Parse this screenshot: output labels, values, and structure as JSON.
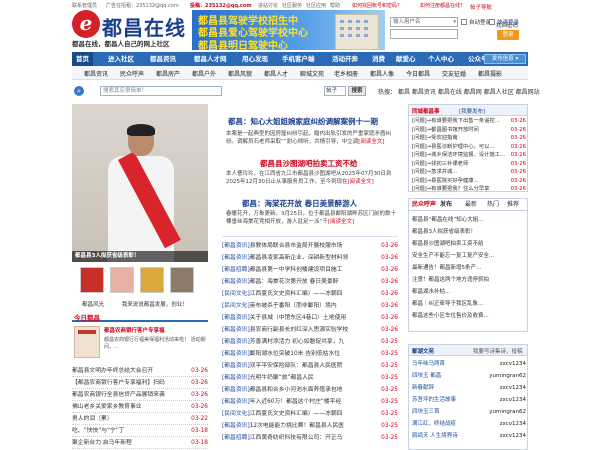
{
  "top_strip": {
    "contact": "联系管理员",
    "ad_phone": "广告在招租：235132@qq.com",
    "submit": "投稿：235132@qq.com",
    "links": [
      "进站讨论",
      "社区服务",
      "社区应用",
      "帮助"
    ],
    "forgot": "如何找回帐号和密码？",
    "register_guide": "如何注册都昌在线？"
  },
  "logo": {
    "mark": "e",
    "text": "都昌在线",
    "slogan": "都昌在线，都昌人自己的网上社区"
  },
  "banner": {
    "line1": "都昌县驾驶学校招生中",
    "line2": "都昌县爱心驾驶学校中心",
    "line3": "都昌县明日驾驶中心"
  },
  "login": {
    "username_placeholder": "输入用户名",
    "remember": "自动登录",
    "quick_login": "快速登录",
    "forgot_pw": "找回密码",
    "fast_reg": "帖子导航",
    "login_btn": "登录"
  },
  "nav": {
    "items": [
      "首页",
      "进入社区",
      "都昌资讯",
      "都昌人才网",
      "用心发现",
      "手机客户端",
      "活动开奔",
      "消费",
      "献爱心",
      "个人中心",
      "公众号"
    ],
    "publish_btn": "发布信息 ▾"
  },
  "subnav": {
    "items": [
      "都昌资讯",
      "民众呼声",
      "都昌房产",
      "都昌户外",
      "都昌风貌",
      "都昌人才",
      "聊城文苑",
      "老乡相册",
      "都昌人像",
      "今日都昌",
      "交友征婚",
      "都昌摄影"
    ]
  },
  "searchbar": {
    "placeholder": "搜索其实很简单！",
    "category": "帖子",
    "go": "搜索",
    "hot_label": "热搜：",
    "hot": [
      "都昌",
      "都昌资讯",
      "都昌在线",
      "都昌网",
      "都昌人社区",
      "都昌网站"
    ]
  },
  "feature": {
    "caption": "都昌县3人拟获省级表彰！",
    "thumbs_caption": "经台下"
  },
  "thumbs_links": [
    "都昌风光",
    "我来说说都昌发展，创业！"
  ],
  "today": {
    "title": "今日都昌",
    "ad_title": "都昌农商银行客户专享福",
    "ad_desc": "都昌农商银行行福美保福利活动来啦！ 活动期间，..."
  },
  "left_list": [
    {
      "title": "都昌县文明办年终总结大会召开",
      "date": "03-26"
    },
    {
      "title": "【都昌农商银行客户专享福利】扫码",
      "date": "03-26"
    },
    {
      "title": "都昌农商银行全县信贷产品展销来袭",
      "date": "03-26"
    },
    {
      "title": "佛山老乡关爱家乡教育事业",
      "date": "03-26"
    },
    {
      "title": "男人的泪（累）",
      "date": "03-22"
    },
    {
      "title": "吃、“快快”与“宁”丁",
      "date": "03-18"
    },
    {
      "title": "聚企新台力 启马年新程",
      "date": "03-18"
    }
  ],
  "mid": {
    "h1": "都昌：知心大姐姐婉家庭纠纷调解案例十一期",
    "p1": "本案是一起典型的因房屋纠纷引起，婚内出轨引发的严重家庭矛盾纠纷。调解员石老师采取“”耐心倾听，共情引导，中立调",
    "p1_more": "[阅读全文]",
    "h2": "都昌县沙图湖吧拍卖工资不给",
    "p2": "本人曹玲玲，在江西省九江市都昌县沙图湖吧从2025年07月30日到2025年12月30日止从事服务员工作，至今到现在",
    "p2_more": "[阅读全文]",
    "h3": "都昌：海棠花开放 春日美景醉游人",
    "p3": "春暖花开，万象更新。3月25日，位于都昌县鄱阳湖畔苏区门前的数十棵垂丝海棠花竞相开放，游人驻足一派“千",
    "p3_more": "[阅读全文]",
    "list": [
      {
        "tag": "[都昌资讯]",
        "title": "县教体局联合县市监局开展校服市场",
        "date": "03-26"
      },
      {
        "tag": "[都昌资讯]",
        "title": "都昌县凌家高新企业，深耕新型材料领",
        "date": "03-26"
      },
      {
        "tag": "[都昌招聘]",
        "title": "都昌县第一中学科创楼建设项目施工",
        "date": "03-26"
      },
      {
        "tag": "[都昌资讯]",
        "title": "都昌：海棠花次第开放 春日美景醉",
        "date": "03-26"
      },
      {
        "tag": "[民间文化]",
        "title": "江西夏氏文史资料汇编）——冻朝四",
        "date": "03-26"
      },
      {
        "tag": "[民间文化]",
        "title": "英布被杀于番阳（而非鄱阳）境内",
        "date": "03-26"
      },
      {
        "tag": "[都昌资讯]",
        "title": "关于县城（中馆东区4巷口）土地使用",
        "date": "03-26"
      },
      {
        "tag": "[都昌资讯]",
        "title": "县农商行副县长刘红深入思源实验学校",
        "date": "03-26"
      },
      {
        "tag": "[都昌资讯]",
        "title": "芳香满村添活力 初心如磐促共享，九",
        "date": "03-25"
      },
      {
        "tag": "[都昌资讯]",
        "title": "鄱阳湖水位突破10米 告别低枯水位",
        "date": "03-25"
      },
      {
        "tag": "[都昌资讯]",
        "title": "双平平安保险部队：都昌县人民医院",
        "date": "03-25"
      },
      {
        "tag": "[都昌资讯]",
        "title": "光明牛奶聚“旅”都昌人民",
        "date": "03-25"
      },
      {
        "tag": "[都昌资讯]",
        "title": "都昌县和合乡小河池水面养殖承包地",
        "date": "03-25"
      },
      {
        "tag": "[都昌资讯]",
        "title": "年入近60万！都昌这个村庄“楼平经",
        "date": "03-25"
      },
      {
        "tag": "[民间文化]",
        "title": "江西夏氏文史资料汇编）——冻朝四",
        "date": "03-25"
      },
      {
        "tag": "[都昌资讯]",
        "title": "12次电能能力挑比赛！都昌县人民医",
        "date": "03-25"
      },
      {
        "tag": "[都昌招聘]",
        "title": "江西黄奇纺织科技有限公司：开正马",
        "date": "03-25"
      }
    ]
  },
  "right": {
    "box1_title": "同城都昌事",
    "box1_more": "[我要发布]",
    "box1": [
      {
        "title": "[问题]→有谁要把我下出售一条遥控...",
        "date": "03-26"
      },
      {
        "title": "[问题]→都昌图书馆开放时间",
        "date": "03-26"
      },
      {
        "title": "[问题]→受欢迎指南",
        "date": "03-26"
      },
      {
        "title": "[问题]→县医诊断护理中心，可以...",
        "date": "03-26"
      },
      {
        "title": "[问题]→城乡保洁环境监督、设计施工...",
        "date": "03-26"
      },
      {
        "title": "[问题]→找初三补课老师",
        "date": "03-26"
      },
      {
        "title": "[问题]→急求并城...",
        "date": "03-26"
      },
      {
        "title": "[问题]→县医院买好孕健康...",
        "date": "03-26"
      },
      {
        "title": "[问题]→有谁要把我？住么分早享",
        "date": "03-26"
      }
    ],
    "box2_tabs": [
      "民众呼声",
      "发布",
      "最新",
      "热门",
      "推荐"
    ],
    "box2": [
      "都昌县“都昌在线”知心大姐...",
      "都昌县3人拟获省级表彰！",
      "都昌县沙图湖吧拍卖工资不给",
      "安全生产不能忘一复工复产安全...",
      "最新通告！都昌新增5条产...",
      "注意！都昌这两个地方违停抓拍",
      "都昌湖水补枯...",
      "都昌｜纠正牵导于我区乱象...",
      "都昌这些小区车位售价及收费..."
    ],
    "box3_title": "鄱湖文苑",
    "box3_more": "我要写诗集诗，投稿",
    "box3": [
      {
        "title": "马年咏马两首",
        "user": "zxcv1234"
      },
      {
        "title": "四块玉 都昌",
        "user": "yumingran62"
      },
      {
        "title": "新春献辞",
        "user": "zxcv1234"
      },
      {
        "title": "苏吾坪的生活故事",
        "user": "zxcv1234"
      },
      {
        "title": "四块玉三首",
        "user": "yumingran62"
      },
      {
        "title": "满江红，终结战疫",
        "user": "zxcv1234"
      },
      {
        "title": "鹧鸪天 人生境界诗",
        "user": "zxcv1234"
      }
    ]
  }
}
